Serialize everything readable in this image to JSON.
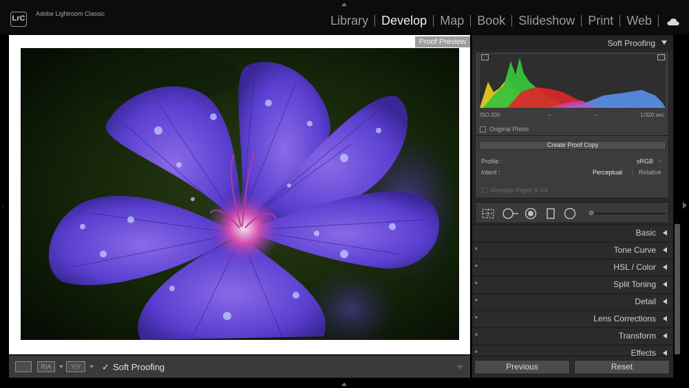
{
  "app": {
    "logo": "LrC",
    "title": "Adobe Lightroom Classic"
  },
  "modules": [
    {
      "label": "Library",
      "active": false
    },
    {
      "label": "Develop",
      "active": true
    },
    {
      "label": "Map",
      "active": false
    },
    {
      "label": "Book",
      "active": false
    },
    {
      "label": "Slideshow",
      "active": false
    },
    {
      "label": "Print",
      "active": false
    },
    {
      "label": "Web",
      "active": false
    }
  ],
  "icons": {
    "cloud": "cloud-icon",
    "soft_proof_check": "checkmark-icon"
  },
  "preview": {
    "proof_tag": "Proof Preview"
  },
  "toolbar": {
    "view_loupe": "",
    "view_before_after": "R|A",
    "view_compare": "Y|Y",
    "soft_proofing_checkmark": "✓",
    "soft_proofing_label": "Soft Proofing"
  },
  "right_panel": {
    "header": "Soft Proofing",
    "histogram": {
      "iso": "ISO 200",
      "dash1": "–",
      "dash2": "–",
      "shutter": "1/320 sec",
      "original_photo_label": "Original Photo"
    },
    "proof": {
      "create_copy_label": "Create Proof Copy",
      "profile_label": "Profile :",
      "profile_value": "sRGB",
      "profile_arrow": "÷",
      "intent_label": "Intent :",
      "intent_perceptual": "Perceptual",
      "intent_relative": "Relative",
      "simulate_label": "Simulate Paper & Ink"
    },
    "sections": [
      "Basic",
      "Tone Curve",
      "HSL / Color",
      "Split Toning",
      "Detail",
      "Lens Corrections",
      "Transform",
      "Effects"
    ],
    "buttons": {
      "previous": "Previous",
      "reset": "Reset"
    }
  },
  "colors": {
    "accent_purple": "#5a3fd0",
    "histogram_green": "#39c23a",
    "histogram_red": "#e0262a",
    "histogram_yellow": "#e8d21c",
    "histogram_blue": "#5a8fe8"
  }
}
